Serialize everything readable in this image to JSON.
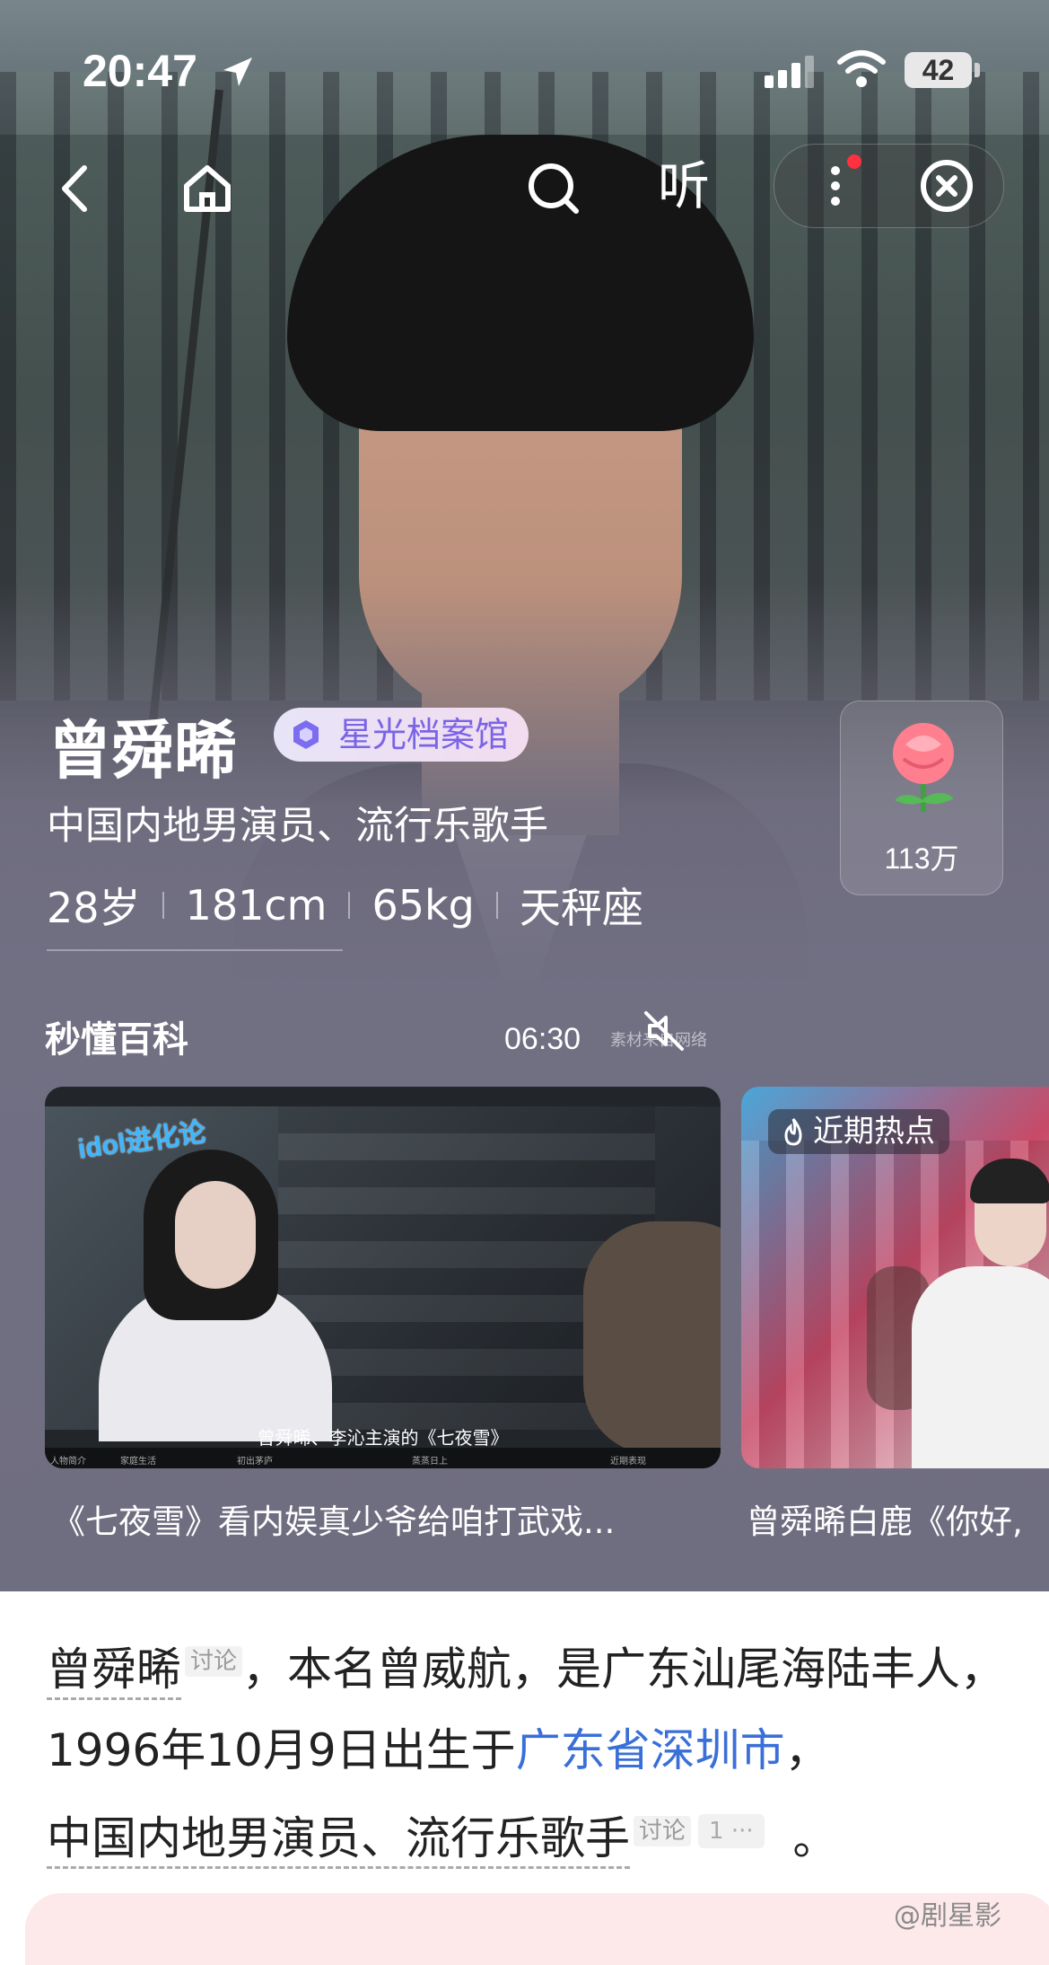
{
  "status_bar": {
    "time": "20:47",
    "battery": "42"
  },
  "header": {
    "listen_label": "听"
  },
  "profile": {
    "name": "曾舜晞",
    "badge": "星光档案馆",
    "intro": "中国内地男演员、流行乐歌手",
    "stats": [
      "28岁",
      "181cm",
      "65kg",
      "天秤座"
    ],
    "flower_count": "113万"
  },
  "section": {
    "title": "秒懂百科"
  },
  "videos": [
    {
      "logo": "idol进化论",
      "duration": "06:30",
      "watermark": "素材来自网络",
      "subtitle": "曾舜晞、李沁主演的《七夜雪》",
      "timeline": [
        "人物简介",
        "家庭生活",
        "初出茅庐",
        "蒸蒸日上",
        "近期表现"
      ],
      "caption": "《七夜雪》看内娱真少爷给咱打武戏..."
    },
    {
      "badge": "近期热点",
      "caption": "曾舜晞白鹿《你好,"
    }
  ],
  "article": {
    "name": "曾舜晞",
    "tag": "讨论",
    "text1": "，本名曾威航，是广东汕尾海陆丰人，1996年10月9日出生于",
    "link": "广东省深圳市",
    "text2": "，",
    "occupation": "中国内地男演员、流行乐歌手",
    "tag2": "讨论",
    "count": "1 ···",
    "end": "。"
  },
  "watermark": "@剧星影",
  "colors": {
    "link": "#3a6fd8",
    "badge_text": "#7a64e6",
    "notification": "#ff3040"
  }
}
